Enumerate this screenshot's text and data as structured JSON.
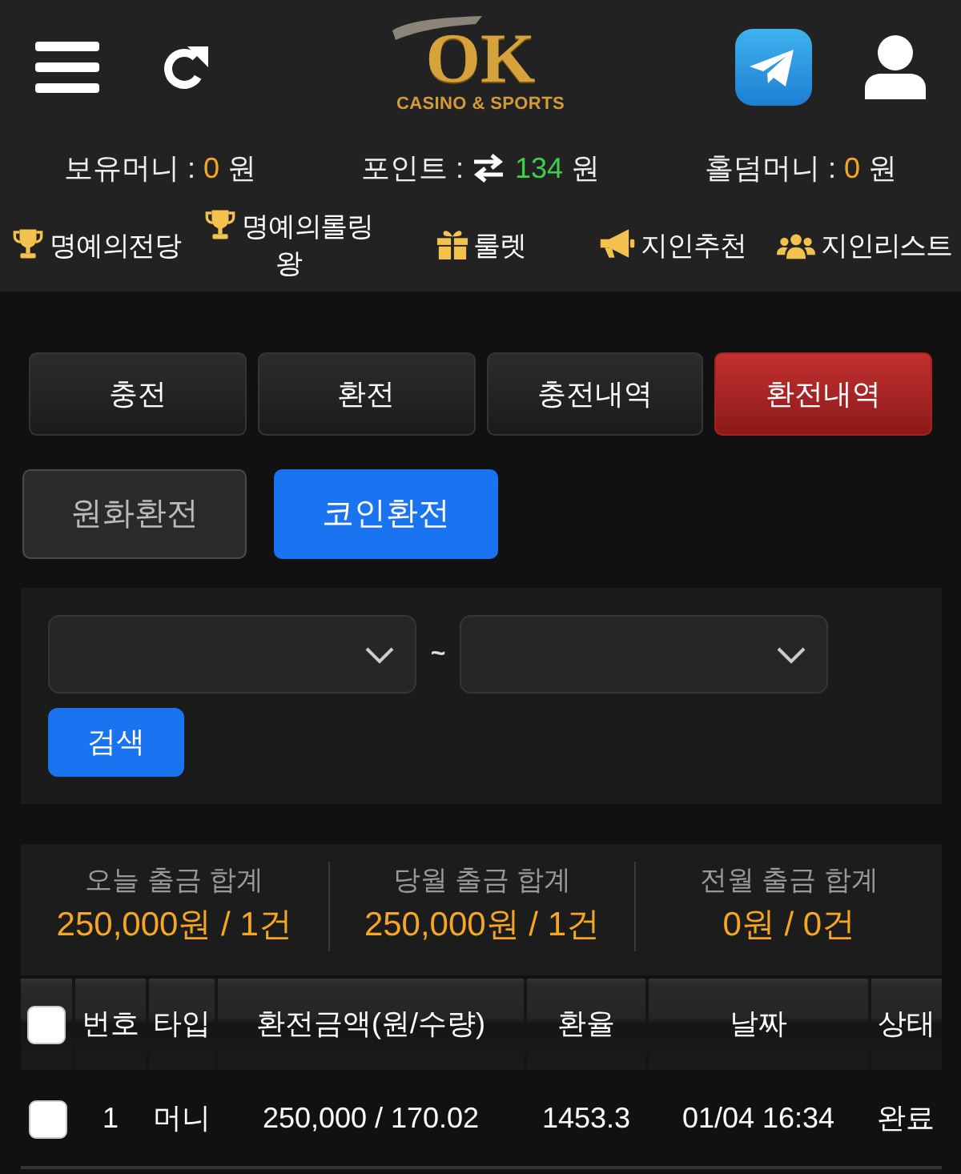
{
  "header": {
    "logo": {
      "title": "OK",
      "subtitle": "CASINO & SPORTS"
    }
  },
  "balances": [
    {
      "label": "보유머니 :",
      "value": "0",
      "unit": "원",
      "kind": "plain",
      "color": "#f5a623"
    },
    {
      "label": "포인트 :",
      "value": "134",
      "unit": "원",
      "kind": "convertible",
      "color": "#3ccf4e"
    },
    {
      "label": "홀덤머니 :",
      "value": "0",
      "unit": "원",
      "kind": "plain",
      "color": "#f5a623"
    }
  ],
  "menu": [
    {
      "label": "명예의전당",
      "kind": "trophy"
    },
    {
      "label": "명예의롤링왕",
      "kind": "trophy"
    },
    {
      "label": "룰렛",
      "kind": "gift"
    },
    {
      "label": "지인추천",
      "kind": "megaphone"
    },
    {
      "label": "지인리스트",
      "kind": "people"
    }
  ],
  "tabs": [
    {
      "label": "충전",
      "selected": false
    },
    {
      "label": "환전",
      "selected": false
    },
    {
      "label": "충전내역",
      "selected": false
    },
    {
      "label": "환전내역",
      "selected": true
    }
  ],
  "sub_tabs": [
    {
      "label": "원화환전",
      "selected": false
    },
    {
      "label": "코인환전",
      "selected": true
    }
  ],
  "filter": {
    "separator": "~",
    "search_button": "검색"
  },
  "summary": [
    {
      "label": "오늘 출금 합계",
      "value": "250,000원 / 1건"
    },
    {
      "label": "당월 출금 합계",
      "value": "250,000원 / 1건"
    },
    {
      "label": "전월 출금 합계",
      "value": "0원 / 0건"
    }
  ],
  "table": {
    "select_all": {
      "checked": false
    },
    "columns": [
      "번호",
      "타입",
      "환전금액(원/수량)",
      "환율",
      "날짜",
      "상태"
    ],
    "rows": [
      {
        "checked": false,
        "cells": [
          "1",
          "머니",
          "250,000 / 170.02",
          "1453.3",
          "01/04 16:34",
          "완료"
        ]
      }
    ]
  }
}
